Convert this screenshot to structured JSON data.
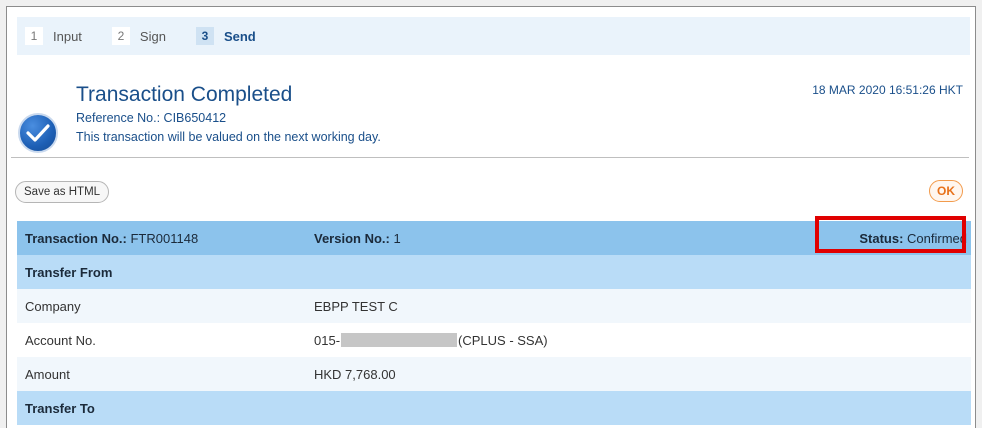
{
  "steps": [
    {
      "num": "1",
      "label": "Input"
    },
    {
      "num": "2",
      "label": "Sign"
    },
    {
      "num": "3",
      "label": "Send"
    }
  ],
  "header": {
    "title": "Transaction Completed",
    "reference": "Reference No.: CIB650412",
    "note": "This transaction will be valued on the next working day.",
    "timestamp": "18 MAR 2020 16:51:26 HKT"
  },
  "buttons": {
    "save_html": "Save as HTML",
    "ok": "OK"
  },
  "summary": {
    "transaction_label": "Transaction No.:",
    "transaction_value": "FTR001148",
    "version_label": "Version No.:",
    "version_value": "1",
    "status_label": "Status:",
    "status_value": "Confirmed"
  },
  "transfer_from": {
    "section_title": "Transfer From",
    "company_label": "Company",
    "company_value": "EBPP TEST C",
    "account_label": "Account No.",
    "account_prefix": "015-",
    "account_suffix": "(CPLUS - SSA)",
    "amount_label": "Amount",
    "amount_value": "HKD 7,768.00"
  },
  "transfer_to": {
    "section_title": "Transfer To"
  },
  "colors": {
    "primary_blue": "#1a4f8a",
    "header_row": "#8cc3ec",
    "section_row": "#b9dcf7",
    "ok_orange": "#e8711a",
    "highlight_red": "#e00000"
  }
}
